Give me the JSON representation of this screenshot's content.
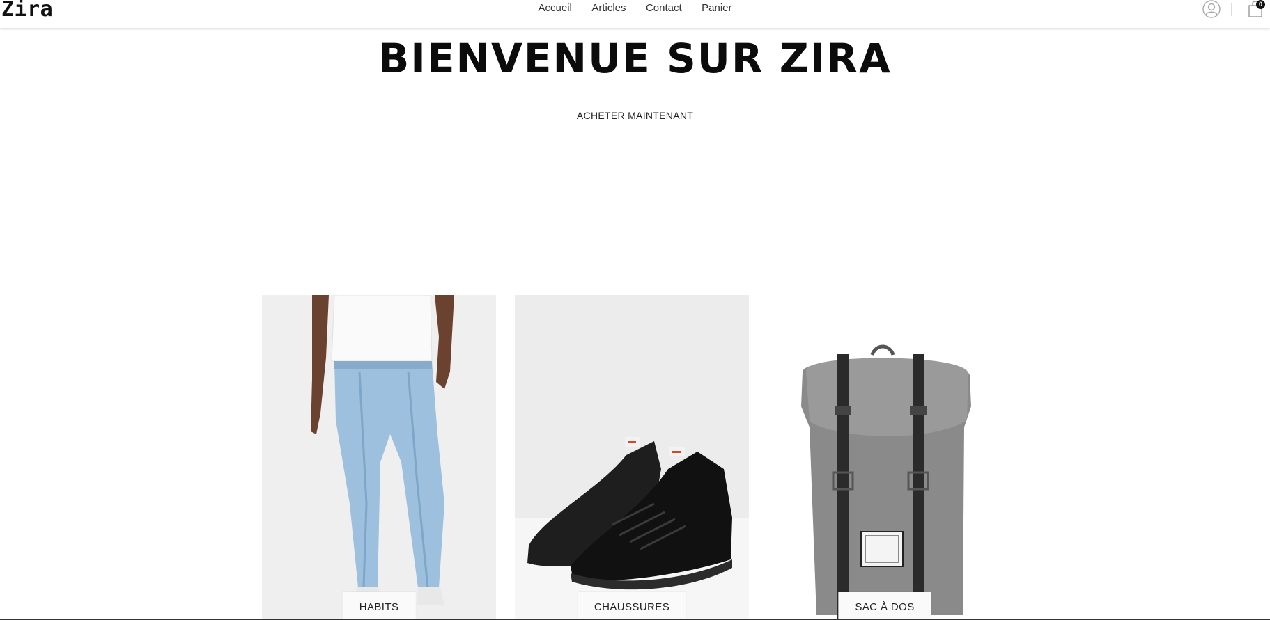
{
  "header": {
    "logo": "Zira",
    "nav": [
      "Accueil",
      "Articles",
      "Contact",
      "Panier"
    ],
    "cart_count": "0",
    "icons": [
      "user-account-icon",
      "shopping-bag-icon"
    ]
  },
  "hero": {
    "title": "BIENVENUE SUR ZIRA",
    "cta": "ACHETER MAINTENANT"
  },
  "categories": [
    {
      "label": "HABITS",
      "image": "jeans-model-photo"
    },
    {
      "label": "CHAUSSURES",
      "image": "black-sneakers-photo"
    },
    {
      "label": "SAC À DOS",
      "image": "grey-backpack-photo"
    }
  ]
}
